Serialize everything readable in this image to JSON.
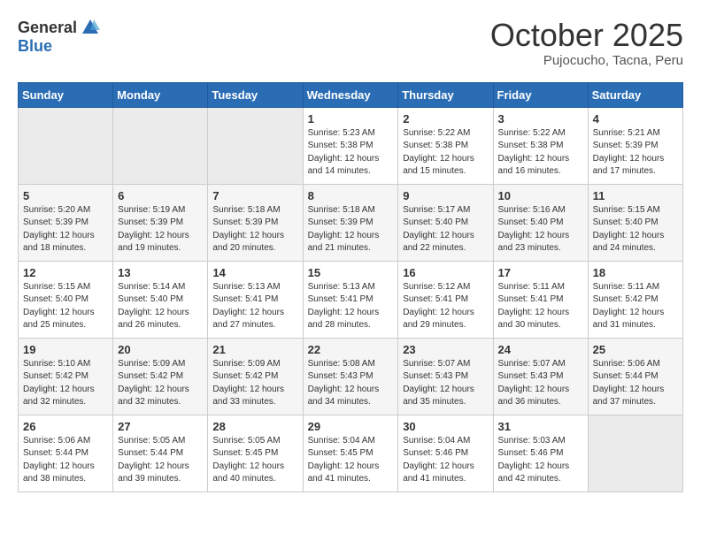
{
  "header": {
    "logo_general": "General",
    "logo_blue": "Blue",
    "title": "October 2025",
    "location": "Pujocucho, Tacna, Peru"
  },
  "days_of_week": [
    "Sunday",
    "Monday",
    "Tuesday",
    "Wednesday",
    "Thursday",
    "Friday",
    "Saturday"
  ],
  "weeks": [
    [
      {
        "day": "",
        "info": ""
      },
      {
        "day": "",
        "info": ""
      },
      {
        "day": "",
        "info": ""
      },
      {
        "day": "1",
        "info": "Sunrise: 5:23 AM\nSunset: 5:38 PM\nDaylight: 12 hours\nand 14 minutes."
      },
      {
        "day": "2",
        "info": "Sunrise: 5:22 AM\nSunset: 5:38 PM\nDaylight: 12 hours\nand 15 minutes."
      },
      {
        "day": "3",
        "info": "Sunrise: 5:22 AM\nSunset: 5:38 PM\nDaylight: 12 hours\nand 16 minutes."
      },
      {
        "day": "4",
        "info": "Sunrise: 5:21 AM\nSunset: 5:39 PM\nDaylight: 12 hours\nand 17 minutes."
      }
    ],
    [
      {
        "day": "5",
        "info": "Sunrise: 5:20 AM\nSunset: 5:39 PM\nDaylight: 12 hours\nand 18 minutes."
      },
      {
        "day": "6",
        "info": "Sunrise: 5:19 AM\nSunset: 5:39 PM\nDaylight: 12 hours\nand 19 minutes."
      },
      {
        "day": "7",
        "info": "Sunrise: 5:18 AM\nSunset: 5:39 PM\nDaylight: 12 hours\nand 20 minutes."
      },
      {
        "day": "8",
        "info": "Sunrise: 5:18 AM\nSunset: 5:39 PM\nDaylight: 12 hours\nand 21 minutes."
      },
      {
        "day": "9",
        "info": "Sunrise: 5:17 AM\nSunset: 5:40 PM\nDaylight: 12 hours\nand 22 minutes."
      },
      {
        "day": "10",
        "info": "Sunrise: 5:16 AM\nSunset: 5:40 PM\nDaylight: 12 hours\nand 23 minutes."
      },
      {
        "day": "11",
        "info": "Sunrise: 5:15 AM\nSunset: 5:40 PM\nDaylight: 12 hours\nand 24 minutes."
      }
    ],
    [
      {
        "day": "12",
        "info": "Sunrise: 5:15 AM\nSunset: 5:40 PM\nDaylight: 12 hours\nand 25 minutes."
      },
      {
        "day": "13",
        "info": "Sunrise: 5:14 AM\nSunset: 5:40 PM\nDaylight: 12 hours\nand 26 minutes."
      },
      {
        "day": "14",
        "info": "Sunrise: 5:13 AM\nSunset: 5:41 PM\nDaylight: 12 hours\nand 27 minutes."
      },
      {
        "day": "15",
        "info": "Sunrise: 5:13 AM\nSunset: 5:41 PM\nDaylight: 12 hours\nand 28 minutes."
      },
      {
        "day": "16",
        "info": "Sunrise: 5:12 AM\nSunset: 5:41 PM\nDaylight: 12 hours\nand 29 minutes."
      },
      {
        "day": "17",
        "info": "Sunrise: 5:11 AM\nSunset: 5:41 PM\nDaylight: 12 hours\nand 30 minutes."
      },
      {
        "day": "18",
        "info": "Sunrise: 5:11 AM\nSunset: 5:42 PM\nDaylight: 12 hours\nand 31 minutes."
      }
    ],
    [
      {
        "day": "19",
        "info": "Sunrise: 5:10 AM\nSunset: 5:42 PM\nDaylight: 12 hours\nand 32 minutes."
      },
      {
        "day": "20",
        "info": "Sunrise: 5:09 AM\nSunset: 5:42 PM\nDaylight: 12 hours\nand 32 minutes."
      },
      {
        "day": "21",
        "info": "Sunrise: 5:09 AM\nSunset: 5:42 PM\nDaylight: 12 hours\nand 33 minutes."
      },
      {
        "day": "22",
        "info": "Sunrise: 5:08 AM\nSunset: 5:43 PM\nDaylight: 12 hours\nand 34 minutes."
      },
      {
        "day": "23",
        "info": "Sunrise: 5:07 AM\nSunset: 5:43 PM\nDaylight: 12 hours\nand 35 minutes."
      },
      {
        "day": "24",
        "info": "Sunrise: 5:07 AM\nSunset: 5:43 PM\nDaylight: 12 hours\nand 36 minutes."
      },
      {
        "day": "25",
        "info": "Sunrise: 5:06 AM\nSunset: 5:44 PM\nDaylight: 12 hours\nand 37 minutes."
      }
    ],
    [
      {
        "day": "26",
        "info": "Sunrise: 5:06 AM\nSunset: 5:44 PM\nDaylight: 12 hours\nand 38 minutes."
      },
      {
        "day": "27",
        "info": "Sunrise: 5:05 AM\nSunset: 5:44 PM\nDaylight: 12 hours\nand 39 minutes."
      },
      {
        "day": "28",
        "info": "Sunrise: 5:05 AM\nSunset: 5:45 PM\nDaylight: 12 hours\nand 40 minutes."
      },
      {
        "day": "29",
        "info": "Sunrise: 5:04 AM\nSunset: 5:45 PM\nDaylight: 12 hours\nand 41 minutes."
      },
      {
        "day": "30",
        "info": "Sunrise: 5:04 AM\nSunset: 5:46 PM\nDaylight: 12 hours\nand 41 minutes."
      },
      {
        "day": "31",
        "info": "Sunrise: 5:03 AM\nSunset: 5:46 PM\nDaylight: 12 hours\nand 42 minutes."
      },
      {
        "day": "",
        "info": ""
      }
    ]
  ]
}
